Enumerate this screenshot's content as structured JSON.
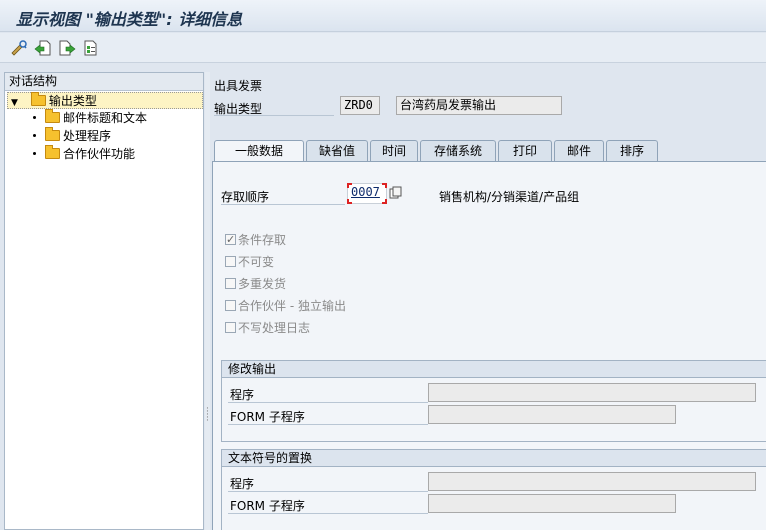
{
  "window": {
    "title": "显示视图 \"输出类型\": 详细信息"
  },
  "toolbar": {
    "icons": [
      "change-display-icon",
      "previous-entry-icon",
      "next-entry-icon",
      "select-entry-icon"
    ]
  },
  "tree": {
    "header": "对话结构",
    "root": {
      "label": "输出类型",
      "icon": "folder-open-icon",
      "selected": true
    },
    "children": [
      {
        "label": "邮件标题和文本",
        "icon": "folder-icon"
      },
      {
        "label": "处理程序",
        "icon": "folder-icon"
      },
      {
        "label": "合作伙伴功能",
        "icon": "folder-icon"
      }
    ]
  },
  "header": {
    "section_title": "出具发票",
    "output_type_label": "输出类型",
    "output_type_code": "ZRD0",
    "output_type_desc": "台湾药局发票输出"
  },
  "tabs": [
    {
      "label": "一般数据",
      "active": true
    },
    {
      "label": "缺省值",
      "active": false
    },
    {
      "label": "时间",
      "active": false
    },
    {
      "label": "存储系统",
      "active": false
    },
    {
      "label": "打印",
      "active": false
    },
    {
      "label": "邮件",
      "active": false
    },
    {
      "label": "排序",
      "active": false
    }
  ],
  "general": {
    "access_seq_label": "存取顺序",
    "access_seq_value": "0007",
    "access_seq_desc": "销售机构/分销渠道/产品组",
    "checkboxes": [
      {
        "label": "条件存取",
        "checked": true
      },
      {
        "label": "不可变",
        "checked": false
      },
      {
        "label": "多重发货",
        "checked": false
      },
      {
        "label": "合作伙伴 - 独立输出",
        "checked": false
      },
      {
        "label": "不写处理日志",
        "checked": false
      }
    ]
  },
  "change_output": {
    "title": "修改输出",
    "program_label": "程序",
    "program_value": "",
    "form_label": "FORM 子程序",
    "form_value": ""
  },
  "text_replace": {
    "title": "文本符号的置换",
    "program_label": "程序",
    "program_value": "",
    "form_label": "FORM 子程序",
    "form_value": ""
  },
  "colors": {
    "title_text": "#1e3550",
    "selected_row": "#fdf4c4",
    "folder": "#f6c12e",
    "focus_marker": "#dd2222"
  }
}
